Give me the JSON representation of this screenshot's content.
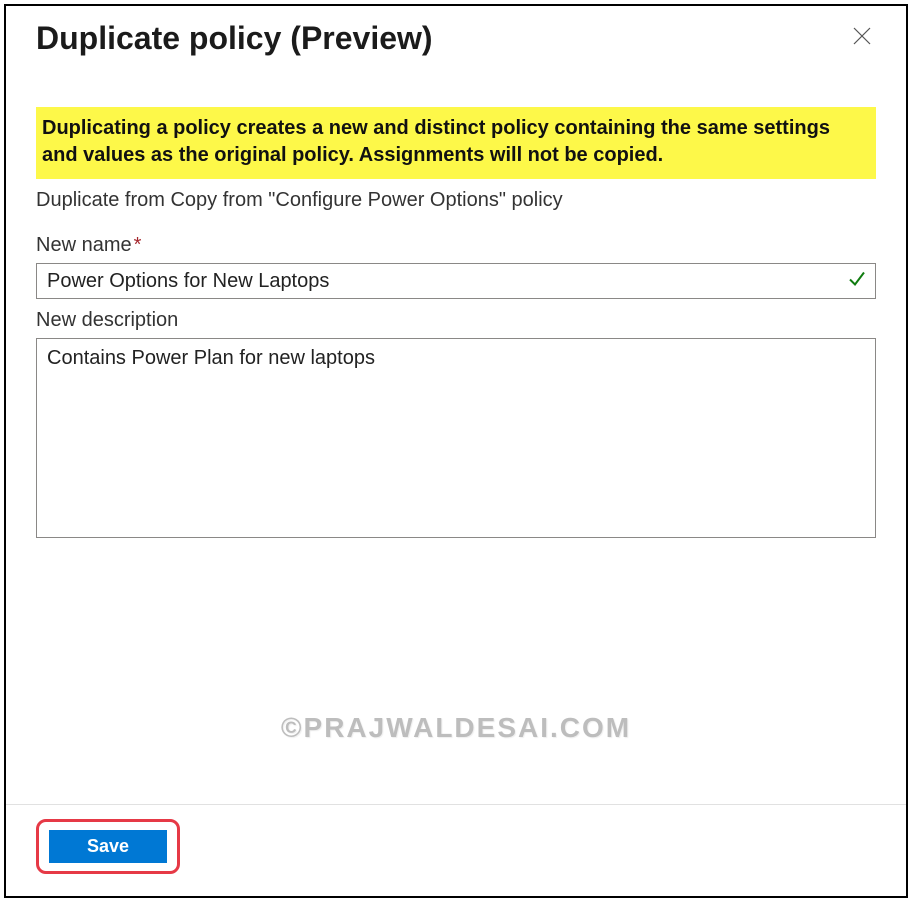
{
  "header": {
    "title": "Duplicate policy (Preview)"
  },
  "banner": {
    "text": "Duplicating a policy creates a new and distinct policy containing the same settings and values as the original policy. Assignments will not be copied."
  },
  "source": {
    "text": "Duplicate from Copy from \"Configure Power Options\" policy"
  },
  "fields": {
    "name": {
      "label": "New name",
      "value": "Power Options for New Laptops",
      "required": true,
      "valid": true
    },
    "description": {
      "label": "New description",
      "value": "Contains Power Plan for new laptops"
    }
  },
  "footer": {
    "save_label": "Save"
  },
  "watermark": "©PRAJWALDESAI.COM"
}
